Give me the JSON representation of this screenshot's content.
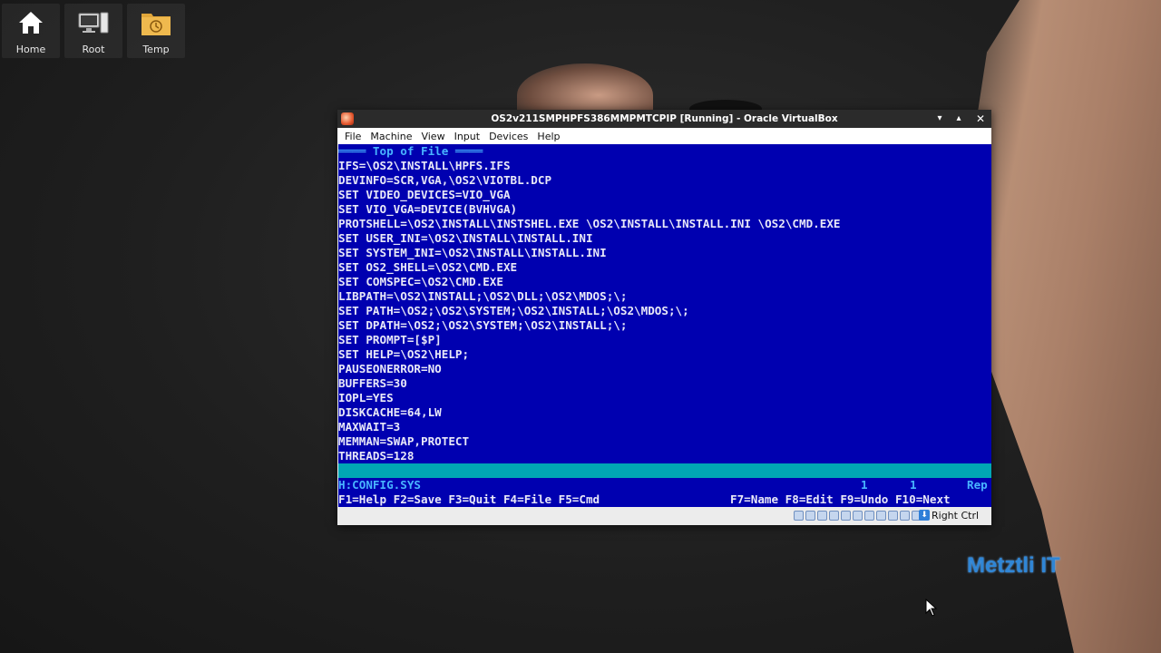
{
  "desktop": {
    "icons": [
      {
        "label": "Home",
        "icon": "home-icon"
      },
      {
        "label": "Root",
        "icon": "computer-icon"
      },
      {
        "label": "Temp",
        "icon": "folder-clock-icon"
      }
    ],
    "watermark": "Metztli IT"
  },
  "window": {
    "title": "OS2v211SMPHPFS386MMPMTCPIP [Running] - Oracle VirtualBox",
    "controls": [
      "minimize",
      "maximize",
      "close"
    ],
    "menu": [
      "File",
      "Machine",
      "View",
      "Input",
      "Devices",
      "Help"
    ],
    "host_key": "Right Ctrl"
  },
  "editor": {
    "top_banner": "════ Top of File ════",
    "lines": [
      "IFS=\\OS2\\INSTALL\\HPFS.IFS",
      "DEVINFO=SCR,VGA,\\OS2\\VIOTBL.DCP",
      "SET VIDEO_DEVICES=VIO_VGA",
      "SET VIO_VGA=DEVICE(BVHVGA)",
      "PROTSHELL=\\OS2\\INSTALL\\INSTSHEL.EXE \\OS2\\INSTALL\\INSTALL.INI \\OS2\\CMD.EXE",
      "SET USER_INI=\\OS2\\INSTALL\\INSTALL.INI",
      "SET SYSTEM_INI=\\OS2\\INSTALL\\INSTALL.INI",
      "SET OS2_SHELL=\\OS2\\CMD.EXE",
      "SET COMSPEC=\\OS2\\CMD.EXE",
      "LIBPATH=\\OS2\\INSTALL;\\OS2\\DLL;\\OS2\\MDOS;\\;",
      "SET PATH=\\OS2;\\OS2\\SYSTEM;\\OS2\\INSTALL;\\OS2\\MDOS;\\;",
      "SET DPATH=\\OS2;\\OS2\\SYSTEM;\\OS2\\INSTALL;\\;",
      "SET PROMPT=[$P]",
      "SET HELP=\\OS2\\HELP;",
      "PAUSEONERROR=NO",
      "BUFFERS=30",
      "IOPL=YES",
      "DISKCACHE=64,LW",
      "MAXWAIT=3",
      "MEMMAN=SWAP,PROTECT",
      "THREADS=128"
    ],
    "status": {
      "file": "H:CONFIG.SYS",
      "line": "1",
      "col": "1",
      "mode": "Rep"
    },
    "fkeys_left": "F1=Help F2=Save F3=Quit F4=File F5=Cmd",
    "fkeys_right": "F7=Name F8=Edit F9=Undo F10=Next"
  },
  "colors": {
    "screen_bg": "#0000b0",
    "screen_fg": "#e8e8f8",
    "highlight": "#48b4ff",
    "bar": "#00a6b4",
    "watermark": "#2f86d6"
  }
}
